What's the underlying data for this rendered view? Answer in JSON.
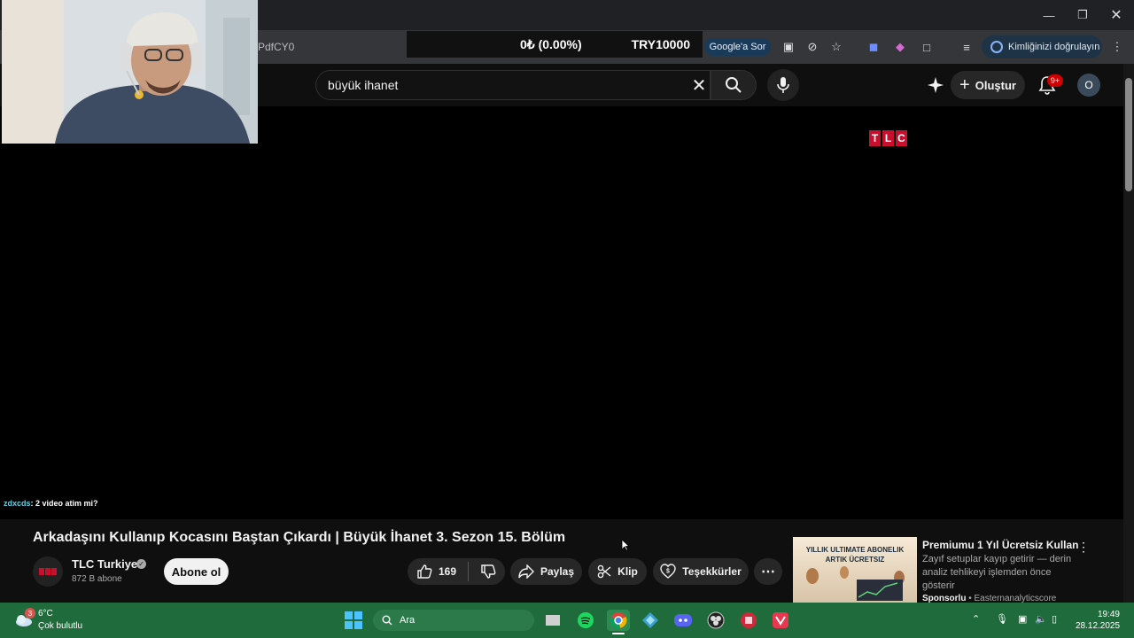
{
  "browser": {
    "url_fragment": "PdfCY0",
    "ticker": {
      "change": "0₺ (0.00%)",
      "asset": "TRY10000"
    },
    "google_sor": "Google'a Sor",
    "identity_label": "Kimliğinizi doğrulayın"
  },
  "youtube": {
    "search": {
      "value": "büyük ihanet"
    },
    "create_label": "Oluştur",
    "notifications_badge": "9+",
    "avatar_letter": "O"
  },
  "player": {
    "watermark": [
      "T",
      "L",
      "C"
    ],
    "chat": {
      "user": "zdxcds",
      "message": ": 2 video atim mi?"
    }
  },
  "video": {
    "title": "Arkadaşını Kullanıp Kocasını Baştan Çıkardı | Büyük İhanet 3. Sezon 15. Bölüm",
    "channel_name": "TLC Turkiye",
    "subscribers": "872 B abone",
    "subscribe_label": "Abone ol",
    "likes": "169",
    "share_label": "Paylaş",
    "clip_label": "Klip",
    "thanks_label": "Teşekkürler"
  },
  "ad": {
    "thumb_line1": "YILLIK ULTIMATE ABONELIK",
    "thumb_line2": "ARTIK ÜCRETSIZ",
    "title": "Premiumu 1 Yıl Ücretsiz Kullan",
    "description": "Zayıf setuplar kayıp getirir — derin analiz tehlikeyi işlemden önce gösterir",
    "sponsored_label": "Sponsorlu",
    "sponsor": " • Easternanalyticscore"
  },
  "taskbar": {
    "weather_badge": "3",
    "temperature": "6°C",
    "condition": "Çok bulutlu",
    "search_placeholder": "Ara",
    "time": "19:49",
    "date": "28.12.2025"
  },
  "colors": {
    "taskbar": "#1f6b3c",
    "brand_red": "#c8102e",
    "page_bg": "#0f0f0f"
  }
}
